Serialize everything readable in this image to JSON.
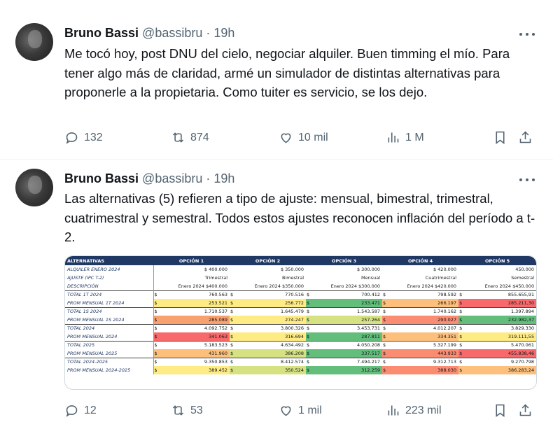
{
  "tweets": [
    {
      "author_name": "Bruno Bassi",
      "handle": "@bassibru",
      "separator": "·",
      "time": "19h",
      "text": "Me tocó hoy, post DNU del cielo, negociar alquiler. Buen timming el mío. Para tener algo más de claridad, armé un simulador de distintas alternativas para proponerle a la propietaria. Como tuiter es servicio, se los dejo.",
      "replies": "132",
      "retweets": "874",
      "likes": "10 mil",
      "views": "1 M"
    },
    {
      "author_name": "Bruno Bassi",
      "handle": "@bassibru",
      "separator": "·",
      "time": "19h",
      "text": "Las alternativas (5) refieren a tipo de ajuste: mensual, bimestral, trimestral, cuatrimestral y semestral. Todos estos ajustes reconocen inflación del período a t-2.",
      "replies": "12",
      "retweets": "53",
      "likes": "1 mil",
      "views": "223 mil"
    }
  ],
  "sheet": {
    "headers": [
      "ALTERNATIVAS",
      "OPCIÓN 1",
      "OPCIÓN 2",
      "OPCIÓN 3",
      "OPCIÓN 4",
      "OPCIÓN 5"
    ],
    "currency": "$",
    "info_rows": [
      {
        "label": "ALQUILER ENERO 2024",
        "values": [
          "$ 400.000",
          "$ 350.000",
          "$ 300.000",
          "$ 420.000",
          "450.000"
        ]
      },
      {
        "label": "AJUSTE (IPC T-2)",
        "values": [
          "Trimestral",
          "Bimestral",
          "Mensual",
          "Cuatrimestral",
          "Semestral"
        ]
      },
      {
        "label": "DESCRIPCIÓN",
        "values": [
          "Enero 2024 $400.000",
          "Enero 2024 $350.000",
          "Enero 2024 $300.000",
          "Enero 2024 $420.000",
          "Enero 2024 $450.000"
        ]
      }
    ],
    "data_rows": [
      {
        "label": "TOTAL 1T 2024",
        "values": [
          "760.563",
          "770.516",
          "700.412",
          "798.592",
          "855.655,91"
        ]
      },
      {
        "label": "PROM MENSUAL 1T 2024",
        "values": [
          "253.521",
          "256.772",
          "233.471",
          "266.197",
          "285.211,30"
        ]
      },
      {
        "label": "TOTAL 1S 2024",
        "values": [
          "1.710.537",
          "1.645.479",
          "1.543.587",
          "1.740.162",
          "1.397.894"
        ]
      },
      {
        "label": "PROM MENSUAL 1S 2024",
        "values": [
          "285.089",
          "274.247",
          "257.264",
          "290.027",
          "232.982,37"
        ]
      },
      {
        "label": "TOTAL 2024",
        "values": [
          "4.092.752",
          "3.800.326",
          "3.453.731",
          "4.012.207",
          "3.829.330"
        ]
      },
      {
        "label": "PROM MENSUAL 2024",
        "values": [
          "341.063",
          "316.694",
          "287.811",
          "334.351",
          "319.111,55"
        ]
      },
      {
        "label": "TOTAL 2025",
        "values": [
          "5.183.523",
          "4.634.492",
          "4.050.208",
          "5.327.199",
          "5.470.061"
        ]
      },
      {
        "label": "PROM MENSUAL 2025",
        "values": [
          "431.960",
          "386.208",
          "337.517",
          "443.933",
          "455.838,46"
        ]
      },
      {
        "label": "TOTAL 2024-2025",
        "values": [
          "9.350.853",
          "8.412.574",
          "7.494.217",
          "9.312.713",
          "9.270.798"
        ]
      },
      {
        "label": "PROM MENSUAL 2024-2025",
        "values": [
          "389.452",
          "350.524",
          "312.259",
          "388.030",
          "386.283,24"
        ]
      }
    ]
  }
}
